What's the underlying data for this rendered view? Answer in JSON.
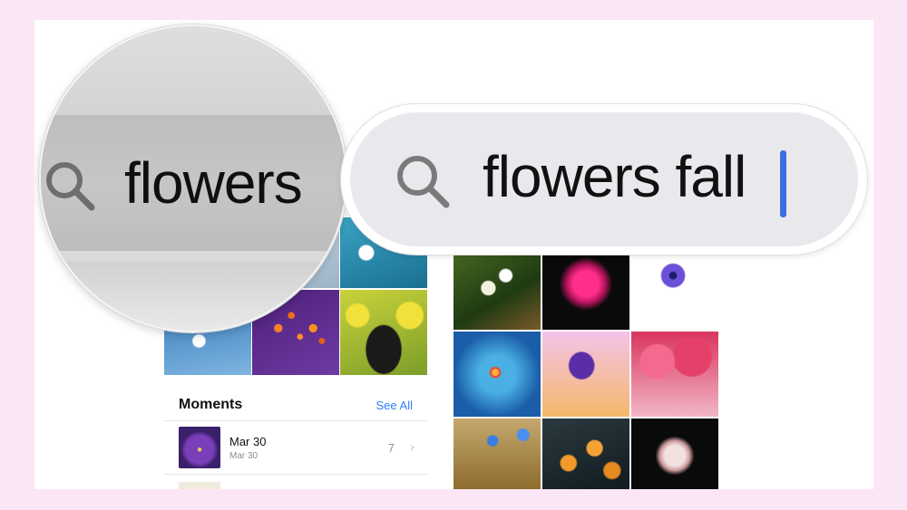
{
  "search": {
    "magnified_query": "flowers",
    "query": "flowers fall"
  },
  "moments": {
    "title": "Moments",
    "see_all_label": "See All",
    "items": [
      {
        "title": "Mar 30",
        "subtitle": "Mar 30",
        "count": "7"
      }
    ]
  },
  "icons": {
    "search": "search-icon",
    "chevron": "chevron-right-icon"
  },
  "colors": {
    "background": "#fbe6f6",
    "link": "#2f7cf6",
    "caret": "#3b6fe0"
  }
}
